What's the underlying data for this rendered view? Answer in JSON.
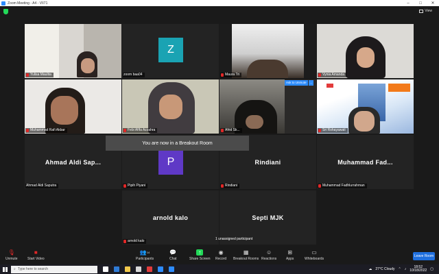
{
  "window": {
    "title": "Zoom Meeting - A4 - VII71"
  },
  "view": {
    "label": "View"
  },
  "tiles": [
    {
      "name": "Yulisa Maulita",
      "muted": true
    },
    {
      "name": "zoom baa04",
      "muted": false,
      "initial": "Z"
    },
    {
      "name": "Maura Tri",
      "muted": true
    },
    {
      "name": "Vynia Amanda",
      "muted": true
    },
    {
      "name": "Muhammad Rafi Akbar",
      "muted": true
    },
    {
      "name": "Febi Afifa Azzahra",
      "muted": true
    },
    {
      "name": "Afrid Sk...",
      "muted": true
    },
    {
      "name": "Sri Rohayawati",
      "muted": true
    },
    {
      "name": "Ahmad Aldi Saputra",
      "display": "Ahmad Aldi Sap...",
      "muted": false
    },
    {
      "name": "Pipih Piyani",
      "muted": true,
      "initial": "P"
    },
    {
      "name": "Rindiani",
      "display": "Rindiani",
      "muted": true
    },
    {
      "name": "Muhammad Fadhlurrahman",
      "display": "Muhammad Fad...",
      "muted": true
    },
    {
      "name": "arnold kalo",
      "display": "arnold kalo",
      "muted": true
    },
    {
      "name": "Septi MJK",
      "display": "Septi MJK",
      "muted": false
    }
  ],
  "ask_unmute": {
    "label": "Ask to Unmute",
    "more": "..."
  },
  "breakout_message": "You are now in a Breakout Room",
  "unassigned_text": "1 unassigned participant",
  "toolbar": {
    "unmute": "Unmute",
    "start_video": "Start Video",
    "participants": "Participants",
    "participants_count": "14",
    "chat": "Chat",
    "share_screen": "Share Screen",
    "record": "Record",
    "breakout_rooms": "Breakout Rooms",
    "reactions": "Reactions",
    "apps": "Apps",
    "whiteboards": "Whiteboards",
    "leave": "Leave Room"
  },
  "taskbar": {
    "search_placeholder": "Type here to search",
    "weather": "27°C  Cloudy",
    "time": "18:52",
    "date": "10/18/2022"
  },
  "colors": {
    "zoom_tile": "#1aa3b3",
    "pipih_tile": "#5f39c6",
    "accent_blue": "#2d8cff",
    "active_speaker": "#c8e23a",
    "share_green": "#23d959"
  }
}
